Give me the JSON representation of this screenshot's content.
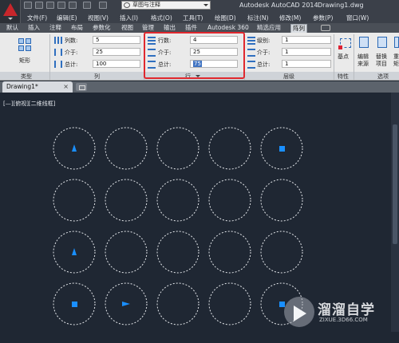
{
  "title_bar": {
    "workspace": "草图与注释",
    "app_title": "Autodesk AutoCAD 2014",
    "doc_title": "Drawing1.dwg"
  },
  "menu": [
    "文件(F)",
    "编辑(E)",
    "视图(V)",
    "插入(I)",
    "格式(O)",
    "工具(T)",
    "绘图(D)",
    "标注(N)",
    "修改(M)",
    "参数(P)",
    "窗口(W)"
  ],
  "ribbon_tabs": [
    "默认",
    "插入",
    "注释",
    "布局",
    "参数化",
    "视图",
    "管理",
    "输出",
    "插件",
    "Autodesk 360",
    "精选应用",
    "阵列"
  ],
  "active_tab": "阵列",
  "ribbon": {
    "type_panel": {
      "button_label": "矩形",
      "title": "类型"
    },
    "columns_panel": {
      "title": "列",
      "fields": [
        {
          "label": "列数:",
          "value": "5"
        },
        {
          "label": "介于:",
          "value": "25"
        },
        {
          "label": "总计:",
          "value": "100"
        }
      ]
    },
    "rows_panel": {
      "title": "行",
      "fields": [
        {
          "label": "行数:",
          "value": "4"
        },
        {
          "label": "介于:",
          "value": "25"
        },
        {
          "label": "总计:",
          "value": "75"
        }
      ]
    },
    "levels_panel": {
      "title": "层级",
      "fields": [
        {
          "label": "级别:",
          "value": "1"
        },
        {
          "label": "介于:",
          "value": "1"
        },
        {
          "label": "总计:",
          "value": "1"
        }
      ]
    },
    "properties_panel": {
      "title": "特性",
      "button_label": "基点"
    },
    "options_panel": {
      "title": "选项",
      "button1": "编辑\n来源",
      "button2": "替换\n项目",
      "button3": "重置\n矩"
    }
  },
  "file_tabs": {
    "active": "Drawing1*"
  },
  "viewport_label": "[—][俯视][二维线框]",
  "drawing": {
    "grid_columns": 5,
    "grid_rows": 4,
    "markers": [
      {
        "row": 0,
        "col": 0,
        "shape": "triangle-up"
      },
      {
        "row": 0,
        "col": 4,
        "shape": "square"
      },
      {
        "row": 2,
        "col": 0,
        "shape": "triangle-up"
      },
      {
        "row": 3,
        "col": 0,
        "shape": "square"
      },
      {
        "row": 3,
        "col": 1,
        "shape": "triangle-right"
      },
      {
        "row": 3,
        "col": 4,
        "shape": "square"
      }
    ],
    "marker_color": "#1a8fff",
    "circle_color": "#e4e7eb"
  },
  "watermark": {
    "text": "溜溜自学",
    "sub": "ZIXUE.3D66.COM"
  },
  "colors": {
    "highlight_box": "#e0282e",
    "canvas_bg": "#1f2733"
  }
}
